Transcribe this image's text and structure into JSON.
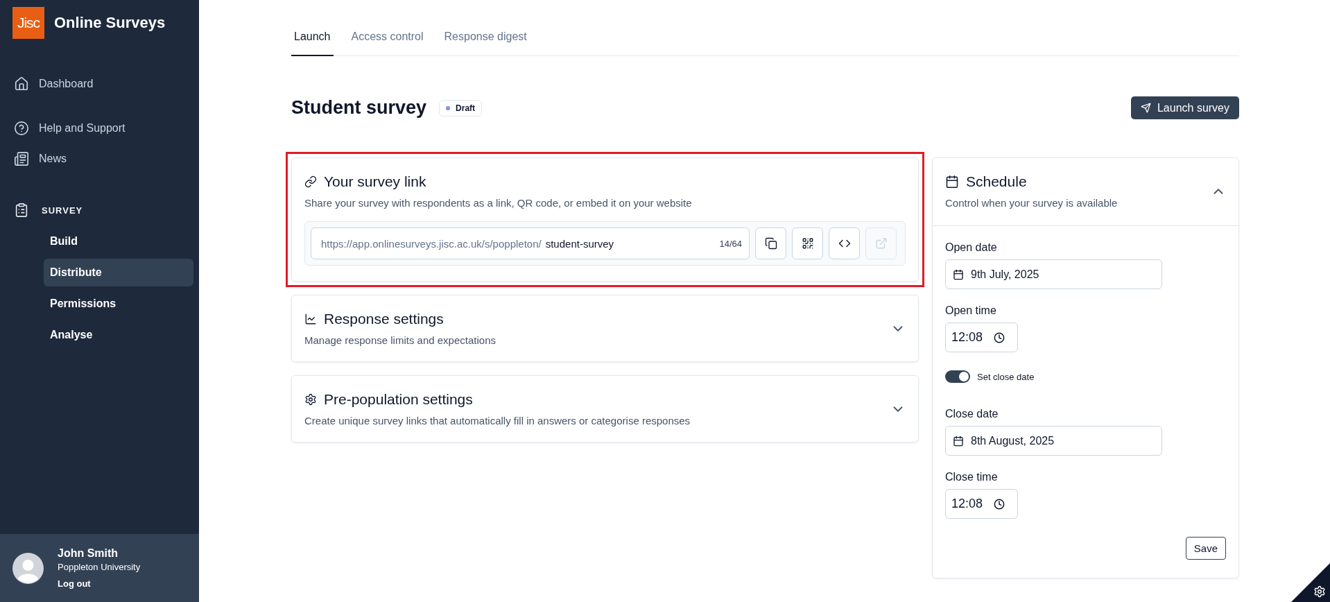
{
  "sidebar": {
    "logo": "Jisc",
    "app_name": "Online Surveys",
    "nav_groups": [
      [
        {
          "label": "Dashboard",
          "kind": "home"
        }
      ],
      [
        {
          "label": "Help and Support",
          "kind": "help"
        },
        {
          "label": "News",
          "kind": "news"
        }
      ]
    ],
    "section": {
      "label": "SURVEY",
      "items": [
        {
          "label": "Build",
          "selected": false
        },
        {
          "label": "Distribute",
          "selected": true
        },
        {
          "label": "Permissions",
          "selected": false
        },
        {
          "label": "Analyse",
          "selected": false
        }
      ]
    },
    "user": {
      "name": "John Smith",
      "organisation": "Poppleton University",
      "logout": "Log out"
    }
  },
  "tabs": [
    {
      "label": "Launch",
      "selected": true
    },
    {
      "label": "Access control",
      "selected": false
    },
    {
      "label": "Response digest",
      "selected": false
    }
  ],
  "header": {
    "title": "Student survey",
    "status": "Draft",
    "launch_button": "Launch survey"
  },
  "link_card": {
    "title": "Your survey link",
    "description": "Share your survey with respondents as a link, QR code, or embed it on your website",
    "url_prefix": "https://app.onlinesurveys.jisc.ac.uk/s/poppleton/",
    "slug": "student-survey",
    "count": "14/64",
    "highlighted": true,
    "actions": [
      {
        "kind": "copy",
        "disabled": false
      },
      {
        "kind": "qr",
        "disabled": false
      },
      {
        "kind": "code",
        "disabled": false
      },
      {
        "kind": "external",
        "disabled": true
      }
    ]
  },
  "sections": [
    {
      "title": "Response settings",
      "description": "Manage response limits and expectations",
      "kind": "chart",
      "expanded": false
    },
    {
      "title": "Pre-population settings",
      "description": "Create unique survey links that automatically fill in answers or categorise responses",
      "kind": "gear",
      "expanded": false
    }
  ],
  "schedule": {
    "title": "Schedule",
    "description": "Control when your survey is available",
    "expanded": true,
    "fields": [
      {
        "kind": "date",
        "label": "Open date",
        "value": "9th July, 2025"
      },
      {
        "kind": "time",
        "label": "Open time",
        "value": "12:08"
      },
      {
        "kind": "toggle",
        "label": "Set close date",
        "on": true
      },
      {
        "kind": "date",
        "label": "Close date",
        "value": "8th August, 2025"
      },
      {
        "kind": "time",
        "label": "Close time",
        "value": "12:08"
      }
    ],
    "save_button": "Save"
  }
}
